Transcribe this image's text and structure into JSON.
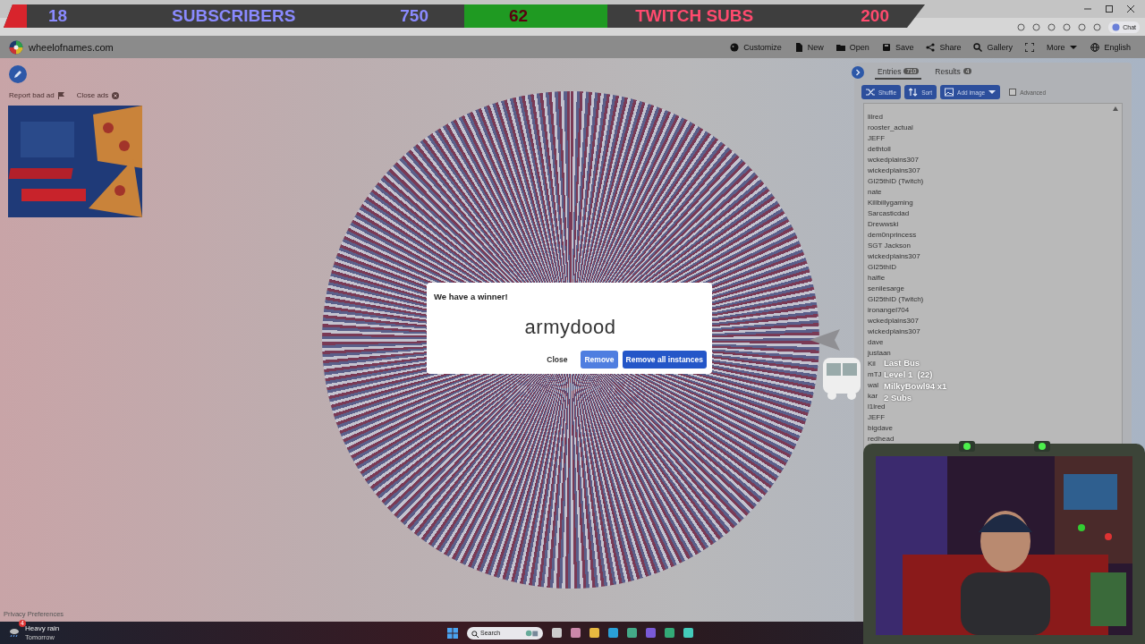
{
  "browser": {
    "chat_button": "Chat"
  },
  "stream_bar": {
    "goals": [
      {
        "count": "18",
        "label": "SUBSCRIBERS",
        "target": "750",
        "level": 0.05,
        "color": "#d8242c"
      },
      {
        "count": "62",
        "label": "TWITCH SUBS",
        "target": "200",
        "level": 0.31,
        "color": "#1f9a22"
      }
    ]
  },
  "site": {
    "name": "wheelofnames.com",
    "menu": [
      {
        "kind": "link",
        "label": "Customize"
      },
      {
        "kind": "link",
        "label": "New"
      },
      {
        "kind": "link",
        "label": "Open"
      },
      {
        "kind": "link",
        "label": "Save"
      },
      {
        "kind": "link",
        "label": "Share"
      },
      {
        "kind": "link",
        "label": "Gallery"
      },
      {
        "kind": "icon"
      },
      {
        "kind": "dropdown",
        "label": "More"
      },
      {
        "kind": "link",
        "label": "English"
      }
    ]
  },
  "ads": {
    "report": "Report bad ad",
    "close": "Close ads",
    "kind": "picture"
  },
  "privacy": "Privacy Preferences",
  "dialog": {
    "title": "We have a winner!",
    "winner": "armydood",
    "buttons": [
      {
        "kind": "text",
        "label": "Close"
      },
      {
        "kind": "light",
        "label": "Remove"
      },
      {
        "kind": "primary",
        "label": "Remove all instances"
      }
    ]
  },
  "panel": {
    "tabs": [
      {
        "label": "Entries",
        "count": "710",
        "selected": true
      },
      {
        "label": "Results",
        "count": "4",
        "selected": false
      }
    ],
    "tools": [
      {
        "label": "Shuffle",
        "dropdown": false
      },
      {
        "label": "Sort",
        "dropdown": false
      },
      {
        "label": "Add image",
        "dropdown": true
      }
    ],
    "advanced": {
      "label": "Advanced",
      "checked": false
    },
    "entries": [
      "lilred",
      "rooster_actual",
      "JEFF",
      "dethtoll",
      "wckedplains307",
      "wickedplains307",
      "GI25thID (Twitch)",
      "nate",
      "Killbillygaming",
      "Sarcasticdad",
      "Drewwski",
      "dem0nprincess",
      "SGT Jackson",
      "wickedplains307",
      "GI25thID",
      "halfie",
      "senilesarge",
      "GI25thID (Twitch)",
      "ironangel704",
      "wckedplains307",
      "wickedplains307",
      "dave",
      "justaan",
      "Kil",
      "mTJ",
      "wal",
      "kar",
      "l1lred",
      "JEFF",
      "bigdave",
      "redhead"
    ]
  },
  "bus": {
    "lines": [
      "Last Bus",
      "Level 1  (22)",
      "MilkyBowl94 x1",
      "2 Subs"
    ]
  },
  "taskbar": {
    "weather": {
      "badge": "4",
      "title": "Heavy rain",
      "subtitle": "Tomorrow"
    },
    "search": {
      "placeholder": "Search"
    }
  }
}
